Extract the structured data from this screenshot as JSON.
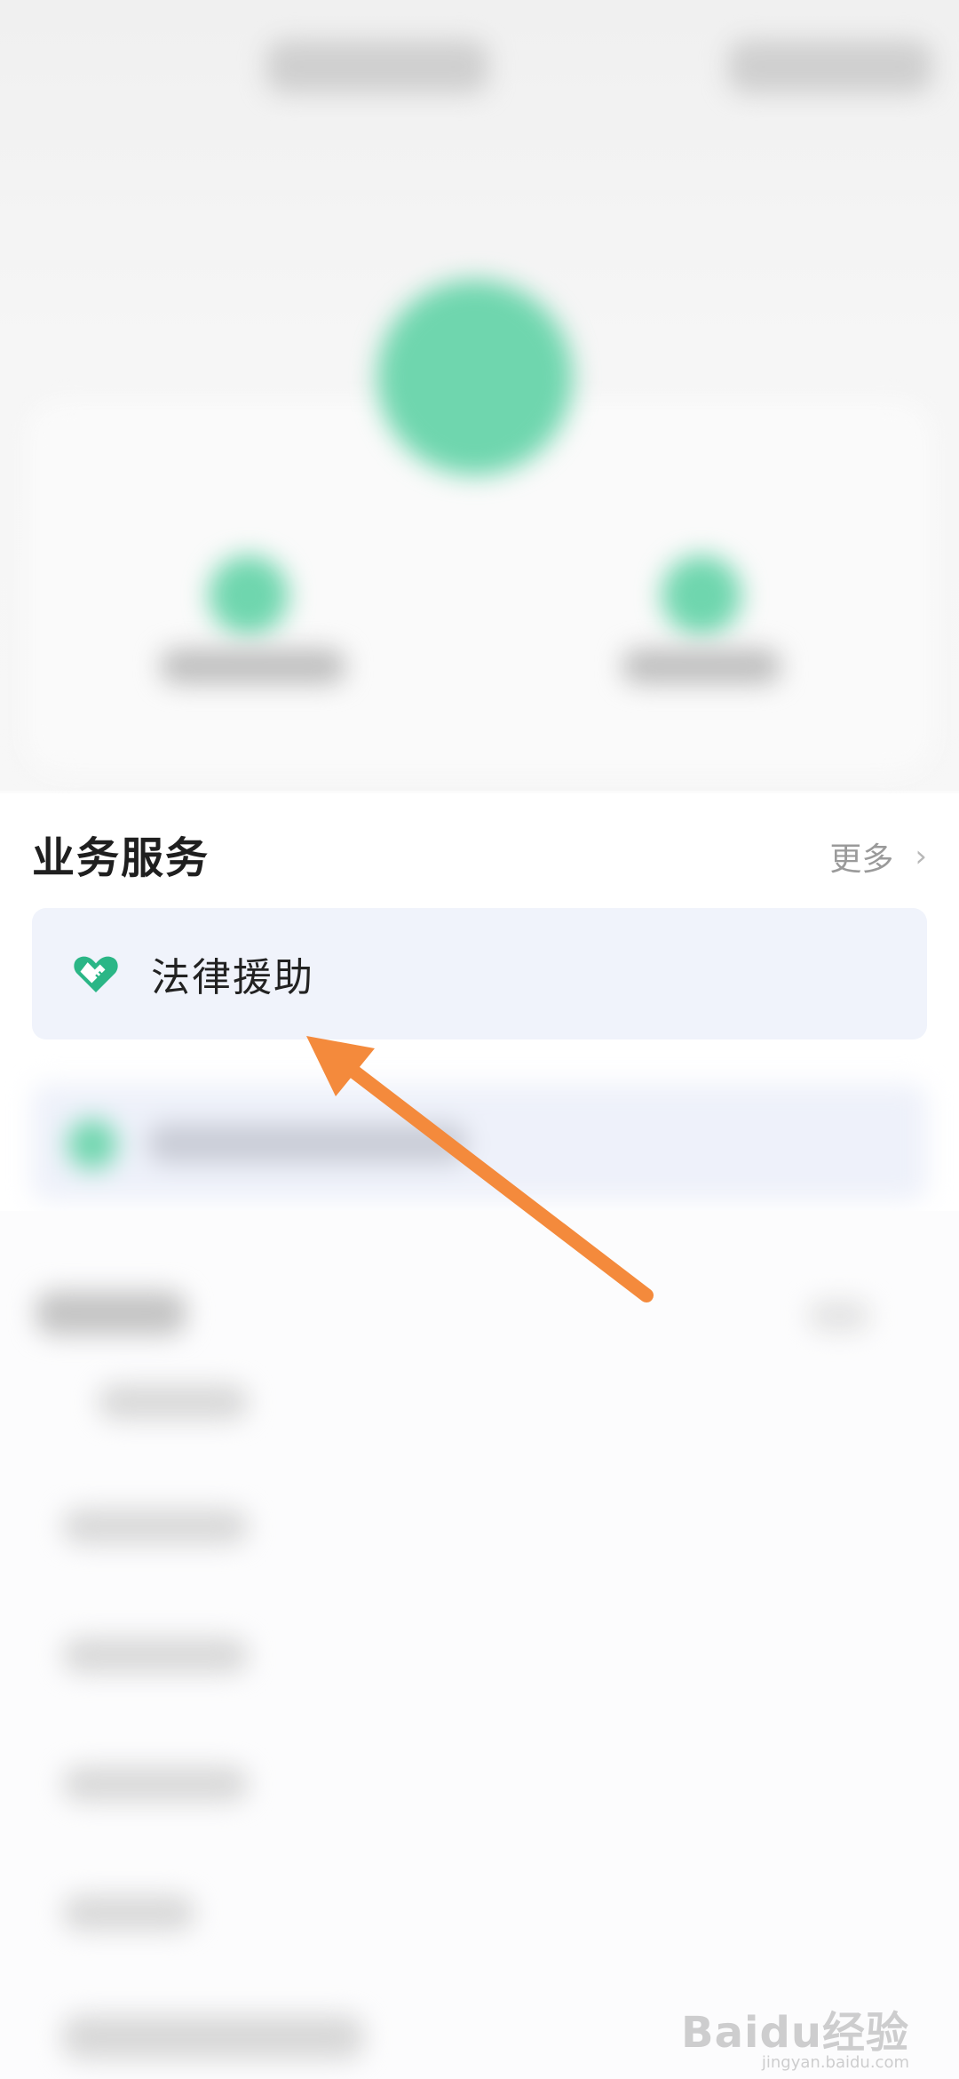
{
  "services": {
    "section_title": "业务服务",
    "more_label": "更多",
    "more_chevron": "›",
    "items": [
      {
        "label": "法律援助",
        "icon": "heart-hand-icon",
        "highlighted": true
      }
    ]
  },
  "colors": {
    "accent_green": "#2bb686",
    "highlight_card": "#f0f3fb",
    "arrow": "#f48a3c"
  },
  "watermark": {
    "brand": "Baidu经验",
    "site": "jingyan.baidu.com"
  }
}
